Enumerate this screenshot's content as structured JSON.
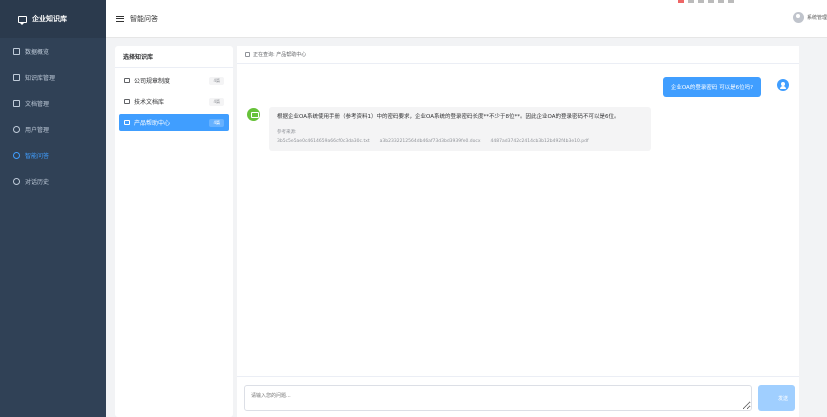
{
  "app": {
    "brand": "企业知识库",
    "page_title": "智能问答",
    "user_name": "系统管理"
  },
  "sidebar": {
    "items": [
      {
        "label": "数据概览",
        "icon": "dashboard-icon"
      },
      {
        "label": "知识库管理",
        "icon": "folder-icon"
      },
      {
        "label": "文档管理",
        "icon": "document-icon"
      },
      {
        "label": "用户管理",
        "icon": "user-icon"
      },
      {
        "label": "智能问答",
        "icon": "chat-icon",
        "active": true
      },
      {
        "label": "对话历史",
        "icon": "history-icon"
      }
    ]
  },
  "kb": {
    "title": "选择知识库",
    "items": [
      {
        "label": "公司规章制度",
        "count": "4篇"
      },
      {
        "label": "技术文档库",
        "count": "4篇"
      },
      {
        "label": "产品帮助中心",
        "count": "4篇",
        "active": true
      }
    ]
  },
  "chat": {
    "current": "正在查询: 产品帮助中心",
    "user_message": "企业OA的登录密码 可以是6位吗?",
    "bot_answer": "根据企业OA系统使用手册（参考资料1）中的密码要求，企业OA系统的登录密码长度**不少于8位**。因此企业OA的登录密码不可以是6位。",
    "ref_title": "参考来源:",
    "refs": [
      "3b5c5e5ae0c4614659a66cf0c3da30c.txt",
      "a3b2332212564db46af73d3bd3939fe0.docx",
      "4487ad3742c2414cb3b12b492f4b3e10.pdf"
    ],
    "input_placeholder": "请输入您的问题...",
    "send_label": "发送"
  },
  "colors": {
    "accent": "#409eff",
    "sidebar_bg": "#304156",
    "bot_avatar": "#67c23a"
  }
}
